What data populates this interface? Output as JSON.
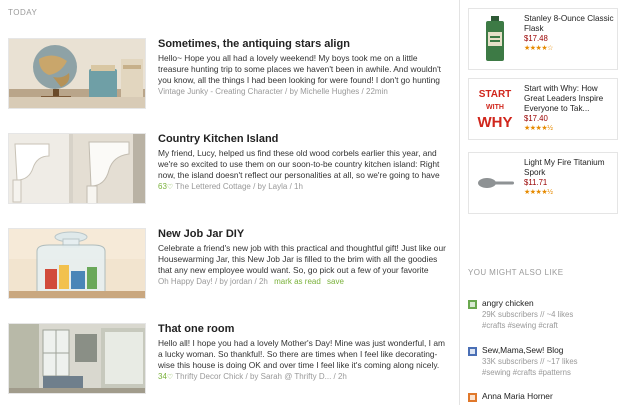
{
  "feed": {
    "section_label": "TODAY",
    "articles": [
      {
        "title": "Sometimes, the antiquing stars align",
        "excerpt": "Hello~  Hope you all had a lovely weekend! My boys took me on a little treasure hunting trip to some places we haven't been in awhile.  And wouldn't you know, all the things I had been looking for were found!  I don't go hunting",
        "source": "Vintage Junky - Creating Character",
        "author": "/ by Michelle Hughes",
        "time": "/ 22min"
      },
      {
        "title": "Country Kitchen Island",
        "excerpt": "My friend, Lucy, helped us find these old wood corbels earlier this year, and we're so excited to use them on our soon-to-be country kitchen island: Right now, the island doesn't reflect our personalities at all, so we're going to have",
        "likes": "63",
        "source": "The Lettered Cottage",
        "author": "/ by Layla",
        "time": "/ 1h"
      },
      {
        "title": "New Job Jar DIY",
        "excerpt": "Celebrate a friend's new job with this practical and thoughtful gift! Just like our Housewarming Jar, this New Job Jar is filled to the brim with all the goodies that any new employee would want. So, go pick out a few of your favorite office",
        "source": "Oh Happy Day!",
        "author": "/ by jordan",
        "time": "/ 2h",
        "mark_as_read": "mark as read",
        "save": "save"
      },
      {
        "title": "That one room",
        "excerpt": "Hello all! I hope you had a lovely Mother's Day! Mine was just wonderful, I am a lucky woman. So thankful!. So there are times when I feel like decorating-wise this house is doing OK and over time I feel like it's coming along nicely. And",
        "likes": "34",
        "source": "Thrifty Decor Chick",
        "author": "/ by Sarah @ Thrifty D...",
        "time": "/ 2h"
      }
    ]
  },
  "products": [
    {
      "title": "Stanley 8-Ounce Classic Flask",
      "price": "$17.48",
      "stars": "★★★★☆",
      "icon": "flask-icon"
    },
    {
      "title": "Start with Why: How Great Leaders Inspire Everyone to Tak...",
      "price": "$17.40",
      "stars": "★★★★½",
      "icon": "book-cover-icon",
      "cover_words": [
        "START",
        "WITH",
        "WHY"
      ]
    },
    {
      "title": "Light My Fire Titanium Spork",
      "price": "$11.71",
      "stars": "★★★★½",
      "icon": "spork-icon"
    }
  ],
  "also_like": {
    "label": "YOU MIGHT ALSO LIKE",
    "items": [
      {
        "name": "angry chicken",
        "stats": "29K subscribers // ~4 likes",
        "tags": "#crafts #sewing #craft",
        "icon": "feed-favicon-green"
      },
      {
        "name": "Sew,Mama,Sew! Blog",
        "stats": "33K subscribers // ~17 likes",
        "tags": "#sewing #crafts #patterns",
        "icon": "feed-favicon-blue"
      },
      {
        "name": "Anna Maria Horner",
        "stats": "",
        "tags": "",
        "icon": "feed-favicon-orange"
      }
    ]
  },
  "colors": {
    "accent_green": "#7ab13b",
    "price_red": "#990000",
    "star_orange": "#e68a00",
    "muted_text": "#999999"
  }
}
